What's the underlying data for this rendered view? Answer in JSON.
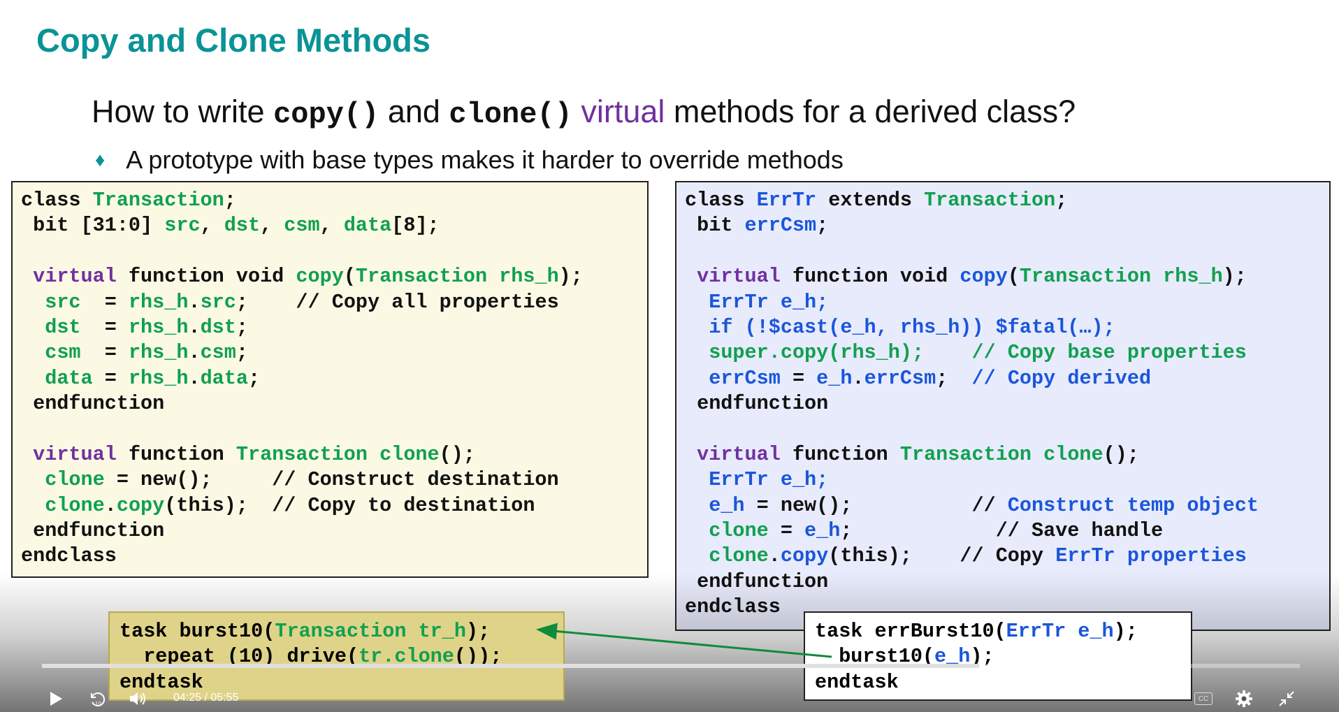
{
  "slide": {
    "title": "Copy and Clone Methods",
    "question": {
      "p1": "How to write ",
      "copy": "copy()",
      "p2": " and ",
      "clone": "clone()",
      "p3": " ",
      "virtual": "virtual",
      "p4": " methods for a derived class?"
    },
    "bullet": "A prototype with base types makes it harder to override methods"
  },
  "left_code": [
    [
      [
        "class ",
        ""
      ],
      [
        "Transaction",
        "gr"
      ],
      [
        ";",
        ""
      ]
    ],
    [
      [
        " bit [31:0] ",
        ""
      ],
      [
        "src",
        "gr"
      ],
      [
        ", ",
        ""
      ],
      [
        "dst",
        "gr"
      ],
      [
        ", ",
        ""
      ],
      [
        "csm",
        "gr"
      ],
      [
        ", ",
        ""
      ],
      [
        "data",
        "gr"
      ],
      [
        "[8];",
        ""
      ]
    ],
    [],
    [
      [
        " ",
        ""
      ],
      [
        "virtual",
        "kw"
      ],
      [
        " function void ",
        ""
      ],
      [
        "copy",
        "gr"
      ],
      [
        "(",
        ""
      ],
      [
        "Transaction rhs_h",
        "gr"
      ],
      [
        ");",
        ""
      ]
    ],
    [
      [
        "  ",
        ""
      ],
      [
        "src",
        "gr"
      ],
      [
        "  = ",
        ""
      ],
      [
        "rhs_h",
        "gr"
      ],
      [
        ".",
        ""
      ],
      [
        "src",
        "gr"
      ],
      [
        ";    // Copy all properties",
        ""
      ]
    ],
    [
      [
        "  ",
        ""
      ],
      [
        "dst",
        "gr"
      ],
      [
        "  = ",
        ""
      ],
      [
        "rhs_h",
        "gr"
      ],
      [
        ".",
        ""
      ],
      [
        "dst",
        "gr"
      ],
      [
        ";",
        ""
      ]
    ],
    [
      [
        "  ",
        ""
      ],
      [
        "csm",
        "gr"
      ],
      [
        "  = ",
        ""
      ],
      [
        "rhs_h",
        "gr"
      ],
      [
        ".",
        ""
      ],
      [
        "csm",
        "gr"
      ],
      [
        ";",
        ""
      ]
    ],
    [
      [
        "  ",
        ""
      ],
      [
        "data",
        "gr"
      ],
      [
        " = ",
        ""
      ],
      [
        "rhs_h",
        "gr"
      ],
      [
        ".",
        ""
      ],
      [
        "data",
        "gr"
      ],
      [
        ";",
        ""
      ]
    ],
    [
      [
        " endfunction",
        ""
      ]
    ],
    [],
    [
      [
        " ",
        ""
      ],
      [
        "virtual",
        "kw"
      ],
      [
        " function ",
        ""
      ],
      [
        "Transaction",
        "gr"
      ],
      [
        " ",
        ""
      ],
      [
        "clone",
        "gr"
      ],
      [
        "();",
        ""
      ]
    ],
    [
      [
        "  ",
        ""
      ],
      [
        "clone",
        "gr"
      ],
      [
        " = new();     // Construct destination",
        ""
      ]
    ],
    [
      [
        "  ",
        ""
      ],
      [
        "clone",
        "gr"
      ],
      [
        ".",
        ""
      ],
      [
        "copy",
        "gr"
      ],
      [
        "(this);  // Copy to destination",
        ""
      ]
    ],
    [
      [
        " endfunction",
        ""
      ]
    ],
    [
      [
        "endclass",
        ""
      ]
    ]
  ],
  "right_code": [
    [
      [
        "class ",
        ""
      ],
      [
        "ErrTr",
        "bl"
      ],
      [
        " extends ",
        ""
      ],
      [
        "Transaction",
        "gr"
      ],
      [
        ";",
        ""
      ]
    ],
    [
      [
        " bit ",
        ""
      ],
      [
        "errCsm",
        "bl"
      ],
      [
        ";",
        ""
      ]
    ],
    [],
    [
      [
        " ",
        ""
      ],
      [
        "virtual",
        "kw"
      ],
      [
        " function void ",
        ""
      ],
      [
        "copy",
        "bl"
      ],
      [
        "(",
        ""
      ],
      [
        "Transaction rhs_h",
        "gr"
      ],
      [
        ");",
        ""
      ]
    ],
    [
      [
        "  ",
        ""
      ],
      [
        "ErrTr e_h;",
        "bl"
      ]
    ],
    [
      [
        "  ",
        ""
      ],
      [
        "if (!$cast(e_h, rhs_h)) $fatal(…);",
        "bl"
      ]
    ],
    [
      [
        "  ",
        ""
      ],
      [
        "super.copy(rhs_h);",
        "gr"
      ],
      [
        "    ",
        ""
      ],
      [
        "// Copy base properties",
        "gr"
      ]
    ],
    [
      [
        "  ",
        ""
      ],
      [
        "errCsm",
        "bl"
      ],
      [
        " = ",
        ""
      ],
      [
        "e_h",
        "bl"
      ],
      [
        ".",
        ""
      ],
      [
        "errCsm",
        "bl"
      ],
      [
        ";  ",
        ""
      ],
      [
        "// Copy derived",
        "bl"
      ]
    ],
    [
      [
        " endfunction",
        ""
      ]
    ],
    [],
    [
      [
        " ",
        ""
      ],
      [
        "virtual",
        "kw"
      ],
      [
        " function ",
        ""
      ],
      [
        "Transaction",
        "gr"
      ],
      [
        " ",
        ""
      ],
      [
        "clone",
        "gr"
      ],
      [
        "();",
        ""
      ]
    ],
    [
      [
        "  ",
        ""
      ],
      [
        "ErrTr e_h;",
        "bl"
      ]
    ],
    [
      [
        "  ",
        ""
      ],
      [
        "e_h",
        "bl"
      ],
      [
        " = new();          // ",
        ""
      ],
      [
        "Construct temp object",
        "bl"
      ]
    ],
    [
      [
        "  ",
        ""
      ],
      [
        "clone",
        "gr"
      ],
      [
        " = ",
        ""
      ],
      [
        "e_h",
        "bl"
      ],
      [
        ";            // Save handle",
        ""
      ]
    ],
    [
      [
        "  ",
        ""
      ],
      [
        "clone",
        "gr"
      ],
      [
        ".",
        ""
      ],
      [
        "copy",
        "bl"
      ],
      [
        "(this);    // Copy ",
        ""
      ],
      [
        "ErrTr properties",
        "bl"
      ]
    ],
    [
      [
        " endfunction",
        ""
      ]
    ],
    [
      [
        "endclass",
        ""
      ]
    ]
  ],
  "task_left": [
    [
      [
        "task burst10(",
        ""
      ],
      [
        "Transaction tr_h",
        "gr"
      ],
      [
        ");",
        ""
      ]
    ],
    [
      [
        "  repeat (10) drive(",
        ""
      ],
      [
        "tr.clone",
        "gr"
      ],
      [
        "());",
        ""
      ]
    ],
    [
      [
        "endtask",
        ""
      ]
    ]
  ],
  "task_right": [
    [
      [
        "task errBurst10(",
        ""
      ],
      [
        "ErrTr e_h",
        "bl"
      ],
      [
        ");",
        ""
      ]
    ],
    [
      [
        "  burst10(",
        ""
      ],
      [
        "e_h",
        "bl"
      ],
      [
        ");",
        ""
      ]
    ],
    [
      [
        "endtask",
        ""
      ]
    ]
  ],
  "player": {
    "current_time": "04:25",
    "separator": "/",
    "duration": "05:55",
    "progress": 0.745,
    "buffered": 0.75,
    "cc_label": "CC",
    "colors": {
      "arrow": "#108a3c"
    }
  }
}
